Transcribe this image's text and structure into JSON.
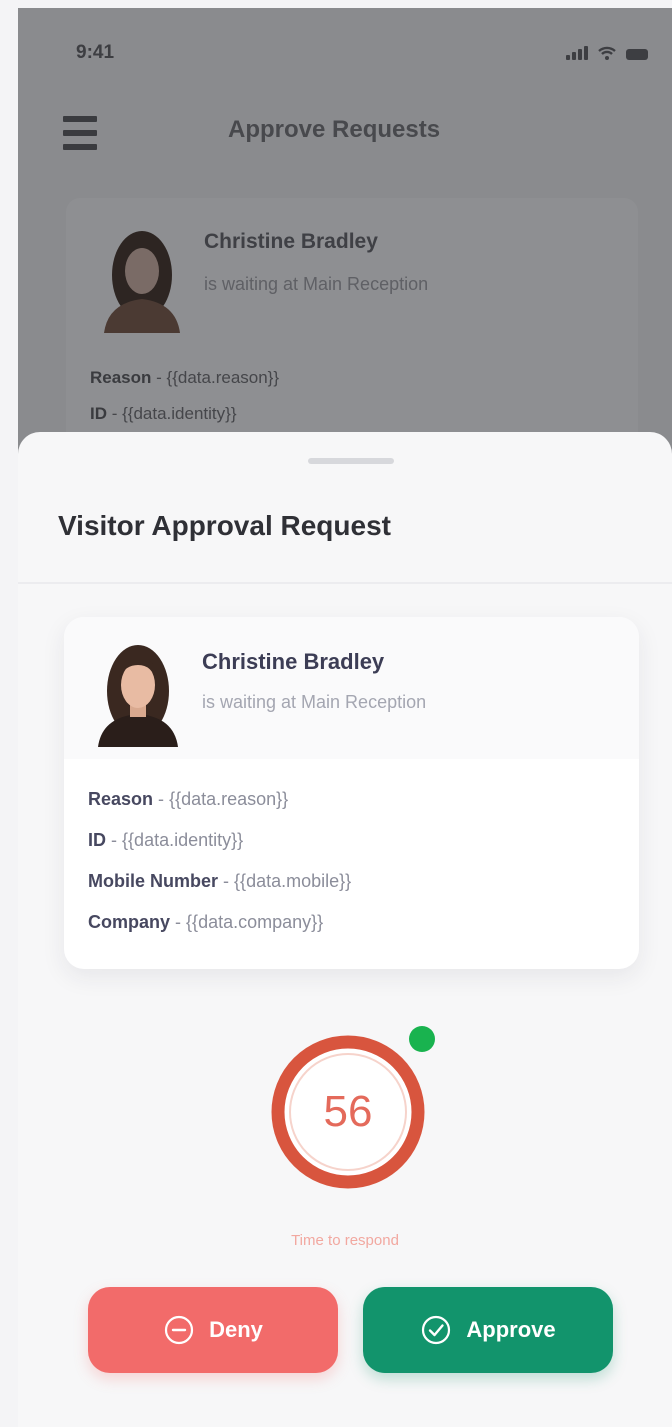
{
  "status_bar": {
    "time": "9:41"
  },
  "background_screen": {
    "title": "Approve Requests",
    "visitor_name": "Christine Bradley",
    "visitor_status": "is waiting at Main Reception",
    "details": [
      {
        "key": "Reason",
        "value": "{{data.reason}}"
      },
      {
        "key": "ID",
        "value": "{{data.identity}}"
      }
    ]
  },
  "sheet": {
    "title": "Visitor Approval Request",
    "visitor_name": "Christine Bradley",
    "visitor_status": "is waiting at Main Reception",
    "details": [
      {
        "key": "Reason",
        "value": "{{data.reason}}"
      },
      {
        "key": "ID",
        "value": "{{data.identity}}"
      },
      {
        "key": "Mobile Number",
        "value": "{{data.mobile}}"
      },
      {
        "key": "Company",
        "value": "{{data.company}}"
      }
    ],
    "detail_separator": "-",
    "timer": {
      "value": "56",
      "label": "Time to respond"
    },
    "deny_label": "Deny",
    "approve_label": "Approve"
  },
  "colors": {
    "deny": "#f26b6a",
    "approve": "#12946c",
    "timer_ring": "#d8553e",
    "online": "#19b34f"
  },
  "icons": {
    "menu": "menu-icon",
    "deny": "minus-circle-icon",
    "approve": "check-circle-icon",
    "signal": "signal-icon",
    "wifi": "wifi-icon",
    "battery": "battery-icon"
  }
}
